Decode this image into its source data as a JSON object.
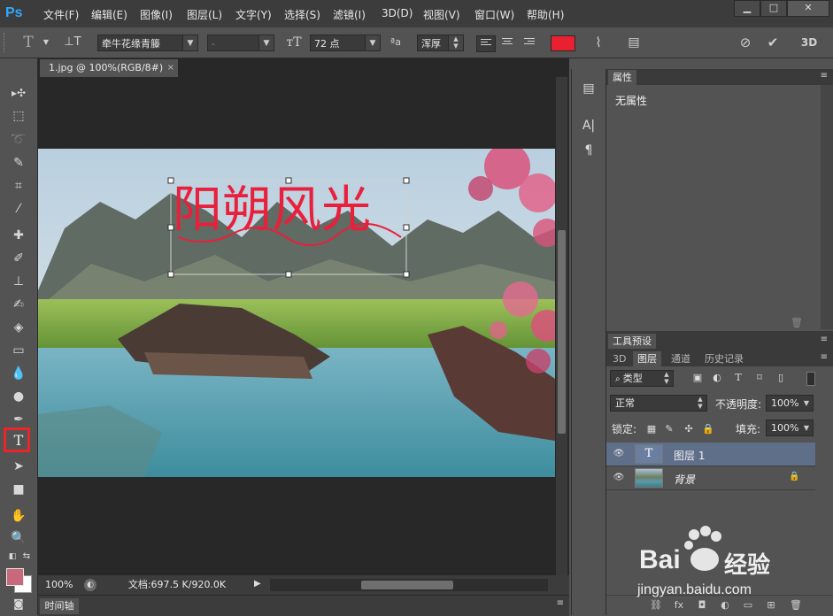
{
  "app": {
    "logo": "Ps"
  },
  "menu": [
    "文件(F)",
    "编辑(E)",
    "图像(I)",
    "图层(L)",
    "文字(Y)",
    "选择(S)",
    "滤镜(I)",
    "3D(D)",
    "视图(V)",
    "窗口(W)",
    "帮助(H)"
  ],
  "window_controls": {
    "minimize": "▁",
    "maximize": "□",
    "close": "✕"
  },
  "options": {
    "font_family": "牵牛花缘青籐",
    "font_style": "-",
    "font_size": "72 点",
    "antialias_icon": "ªa",
    "antialias": "浑厚",
    "text_color": "#e8202f",
    "mode_3d": "3D"
  },
  "document": {
    "tab_title": "1.jpg @ 100%(RGB/8#)",
    "tab_close": "×",
    "canvas_text": "阳朔风光",
    "zoom": "100%",
    "doc_size": "文档:697.5 K/920.0K"
  },
  "timeline": {
    "tab": "时间轴"
  },
  "properties": {
    "tab": "属性",
    "content": "无属性"
  },
  "presets": {
    "tab": "工具预设"
  },
  "layers": {
    "tabs": [
      "3D",
      "图层",
      "通道",
      "历史记录"
    ],
    "filter_kind": "类型",
    "blend_mode": "正常",
    "opacity_label": "不透明度:",
    "opacity_value": "100%",
    "lock_label": "锁定:",
    "fill_label": "填充:",
    "fill_value": "100%",
    "items": [
      {
        "name": "图层 1",
        "type": "text",
        "selected": true
      },
      {
        "name": "背景",
        "type": "image",
        "selected": false
      }
    ]
  },
  "watermark": {
    "brand": "Bai",
    "brand_cn": "经验",
    "url": "jingyan.baidu.com"
  }
}
